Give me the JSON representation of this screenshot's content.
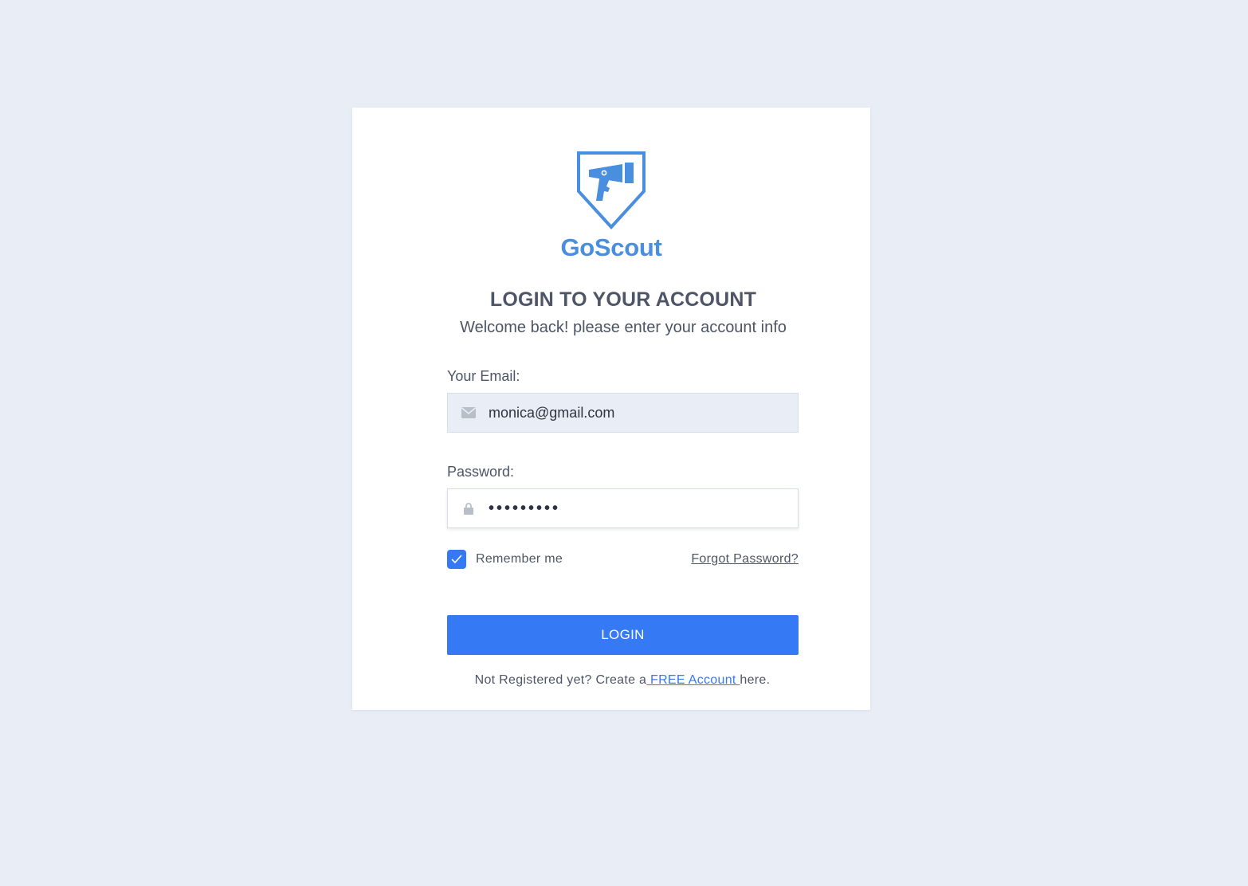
{
  "brand": {
    "name": "GoScout",
    "color": "#4a8ee0"
  },
  "heading": {
    "title": "LOGIN TO YOUR ACCOUNT",
    "subtitle": "Welcome back! please enter your account info"
  },
  "form": {
    "email": {
      "label": "Your Email:",
      "value": "monica@gmail.com",
      "icon": "envelope-icon"
    },
    "password": {
      "label": "Password:",
      "value": "•••••••••",
      "icon": "lock-icon"
    },
    "remember": {
      "label": "Remember me",
      "checked": true
    },
    "forgot_label": "Forgot Password?",
    "login_label": "LOGIN"
  },
  "register": {
    "prefix": "Not Registered yet? Create a",
    "link": " FREE Account ",
    "suffix": "here."
  },
  "colors": {
    "accent": "#3679f5",
    "background": "#e9edf6",
    "text": "#4d5566"
  }
}
